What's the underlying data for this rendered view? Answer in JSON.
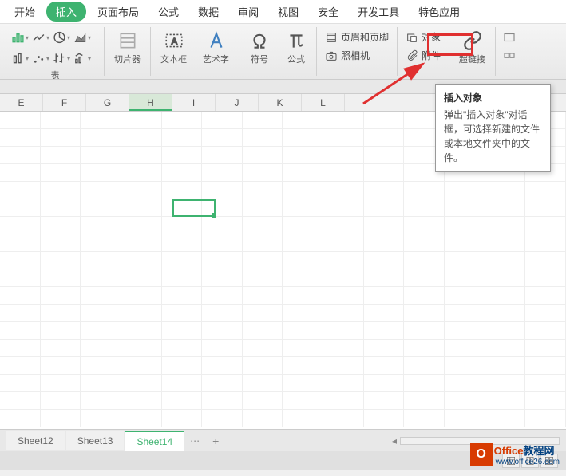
{
  "menu": {
    "start": "开始",
    "insert": "插入",
    "page_layout": "页面布局",
    "formula": "公式",
    "data": "数据",
    "review": "审阅",
    "view": "视图",
    "security": "安全",
    "dev_tools": "开发工具",
    "special": "特色应用"
  },
  "ribbon": {
    "table_label": "表",
    "slicer_label": "切片器",
    "textbox_label": "文本框",
    "wordart_label": "艺术字",
    "symbol_label": "符号",
    "formula_label": "公式",
    "header_footer": "页眉和页脚",
    "camera": "照相机",
    "object": "对象",
    "attachment": "附件",
    "hyperlink": "超链接"
  },
  "tooltip": {
    "title": "插入对象",
    "body": "弹出\"插入对象\"对话框，可选择新建的文件或本地文件夹中的文件。"
  },
  "columns": [
    "E",
    "F",
    "G",
    "H",
    "I",
    "J",
    "K",
    "L"
  ],
  "selected_column": "H",
  "sheets": {
    "tab1": "Sheet12",
    "tab2": "Sheet13",
    "tab3": "Sheet14"
  },
  "watermark": {
    "brand": "Office",
    "suffix": "教程网",
    "url": "www.office26.com"
  }
}
